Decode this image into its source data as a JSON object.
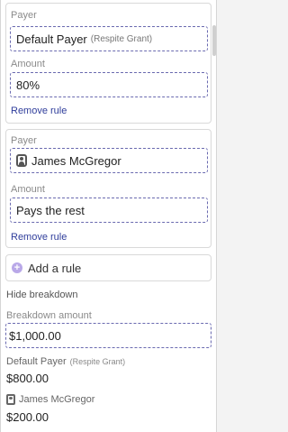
{
  "rules": [
    {
      "payer_label": "Payer",
      "payer_value": "Default Payer",
      "payer_sub": "(Respite Grant)",
      "amount_label": "Amount",
      "amount_value": "80%",
      "remove_label": "Remove rule"
    },
    {
      "payer_label": "Payer",
      "payer_value": "James McGregor",
      "payer_icon": "person-icon",
      "amount_label": "Amount",
      "amount_value": "Pays the rest",
      "remove_label": "Remove rule"
    }
  ],
  "add_rule": {
    "label": "Add a rule",
    "icon": "plus-icon"
  },
  "breakdown": {
    "toggle_label": "Hide breakdown",
    "amount_label": "Breakdown amount",
    "amount_value": "$1,000.00",
    "payers": [
      {
        "name": "Default Payer",
        "sub": "(Respite Grant)",
        "amount": "$800.00"
      },
      {
        "name": "James McGregor",
        "icon": "person-icon",
        "amount": "$200.00"
      }
    ]
  },
  "colors": {
    "link": "#2f3d9b",
    "dashed_border": "#6a6ab0",
    "plus_icon": "#b9a8e8"
  }
}
